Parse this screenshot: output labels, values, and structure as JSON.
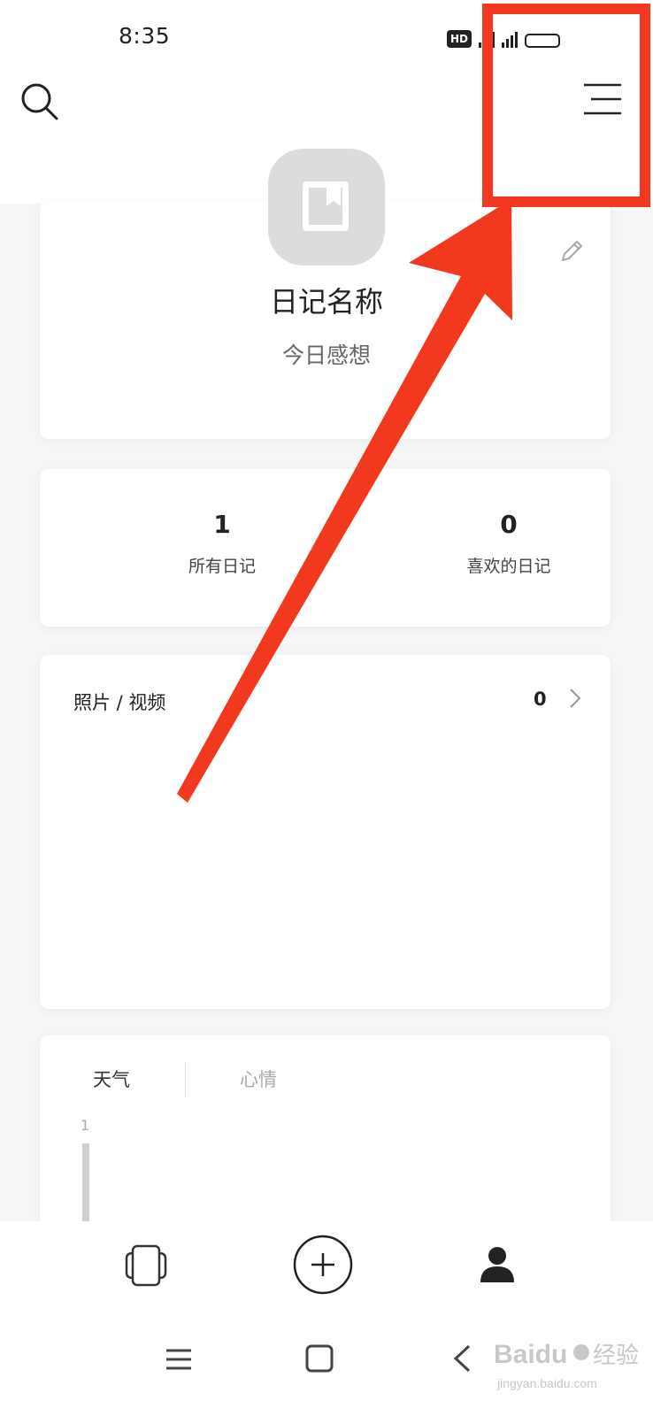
{
  "status_bar": {
    "time": "8:35",
    "hd_badge": "HD"
  },
  "header": {
    "search_icon": "search-icon",
    "menu_icon": "hamburger-menu-icon"
  },
  "profile": {
    "avatar_icon": "notebook-icon",
    "diary_name": "日记名称",
    "subtitle": "今日感想",
    "edit_icon": "pencil-icon"
  },
  "stats": {
    "all_count": "1",
    "all_label": "所有日记",
    "fav_count": "0",
    "fav_label": "喜欢的日记"
  },
  "media": {
    "title": "照片 / 视频",
    "count": "0"
  },
  "chart_section": {
    "tab_weather": "天气",
    "tab_mood": "心情",
    "active_tab": "天气"
  },
  "chart_data": {
    "type": "bar",
    "categories": [
      ""
    ],
    "values": [
      1
    ],
    "yticks": [
      "1"
    ],
    "title": "",
    "xlabel": "",
    "ylabel": ""
  },
  "bottom_nav": {
    "items": [
      {
        "icon": "diary-cards-icon"
      },
      {
        "icon": "add-icon"
      },
      {
        "icon": "profile-icon"
      }
    ]
  },
  "system_nav": {
    "items": [
      "menu",
      "home",
      "back"
    ]
  },
  "watermark": {
    "brand": "Baidu",
    "suffix": "经验",
    "url": "jingyan.baidu.com"
  },
  "colors": {
    "annotation_red": "#f2391f",
    "card_bg": "#ffffff",
    "page_bg": "#f6f6f6",
    "avatar_bg": "#dcdcdc"
  }
}
